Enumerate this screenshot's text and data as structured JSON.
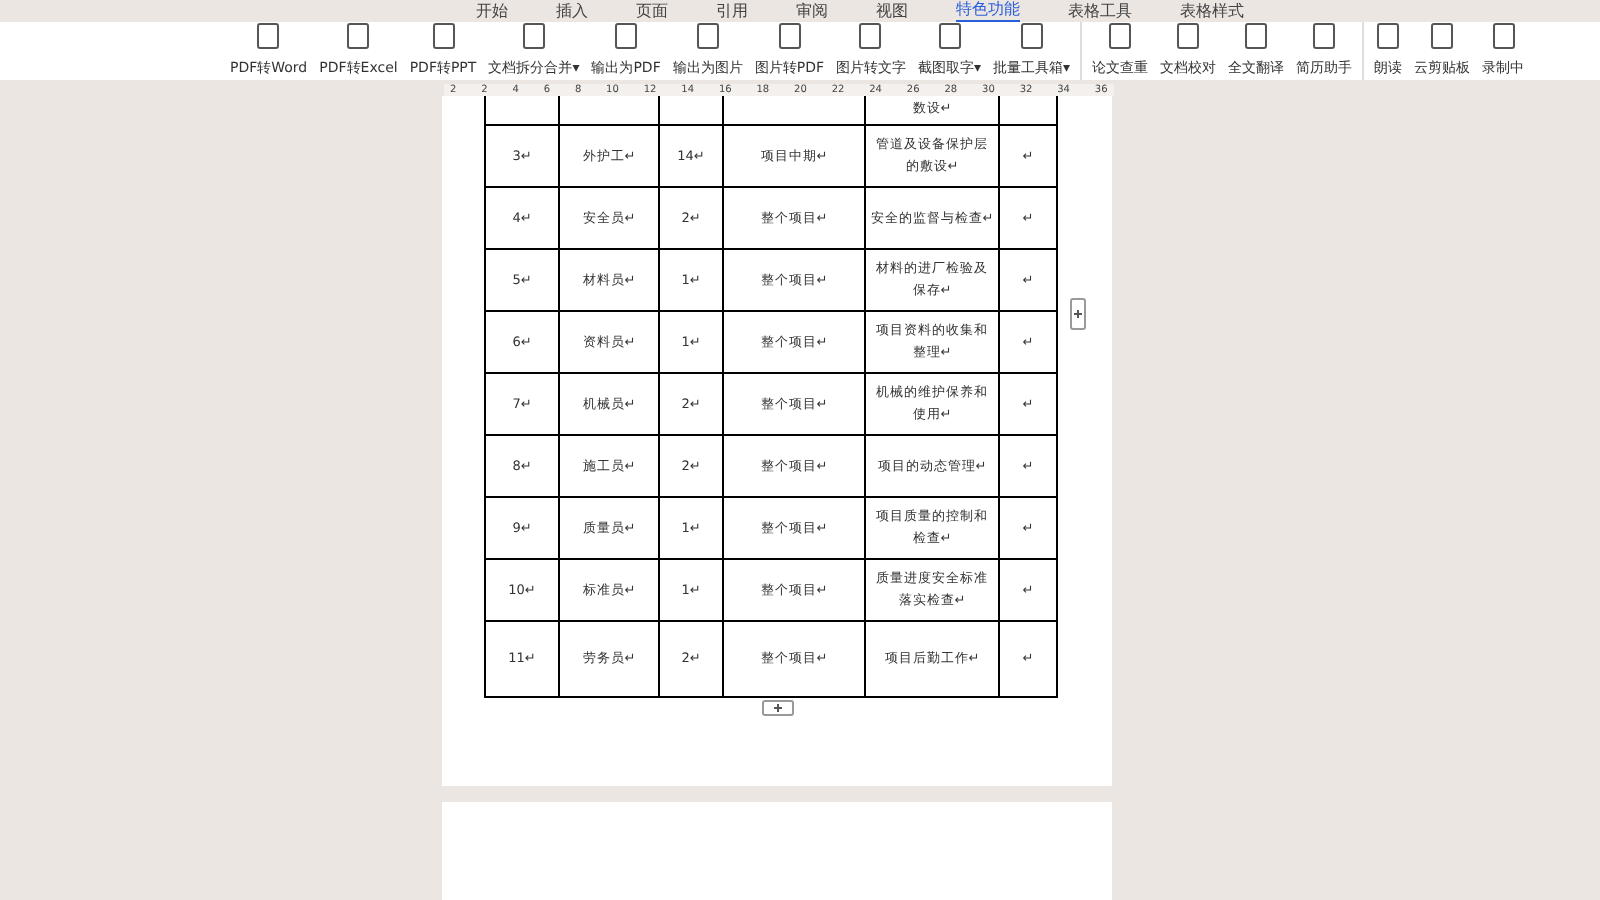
{
  "menu_tabs": [
    {
      "label": "开始",
      "selected": false
    },
    {
      "label": "插入",
      "selected": false
    },
    {
      "label": "页面",
      "selected": false
    },
    {
      "label": "引用",
      "selected": false
    },
    {
      "label": "审阅",
      "selected": false
    },
    {
      "label": "视图",
      "selected": false
    },
    {
      "label": "特色功能",
      "selected": true
    },
    {
      "label": "表格工具",
      "selected": false
    },
    {
      "label": "表格样式",
      "selected": false
    }
  ],
  "toolbar_groups": [
    [
      {
        "label": "PDF转Word"
      },
      {
        "label": "PDF转Excel"
      },
      {
        "label": "PDF转PPT"
      },
      {
        "label": "文档拆分合并▾"
      },
      {
        "label": "输出为PDF"
      },
      {
        "label": "输出为图片"
      },
      {
        "label": "图片转PDF"
      },
      {
        "label": "图片转文字"
      },
      {
        "label": "截图取字▾"
      },
      {
        "label": "批量工具箱▾"
      }
    ],
    [
      {
        "label": "论文查重"
      },
      {
        "label": "文档校对"
      },
      {
        "label": "全文翻译"
      },
      {
        "label": "简历助手"
      }
    ],
    [
      {
        "label": "朗读"
      },
      {
        "label": "云剪贴板"
      },
      {
        "label": "录制中"
      }
    ]
  ],
  "ruler": [
    "2",
    "2",
    "4",
    "6",
    "8",
    "10",
    "12",
    "14",
    "16",
    "18",
    "20",
    "22",
    "24",
    "26",
    "28",
    "30",
    "32",
    "34",
    "36"
  ],
  "table": {
    "rows": [
      [
        "",
        "",
        "",
        "",
        "数设↵",
        ""
      ],
      [
        "3↵",
        "外护工↵",
        "14↵",
        "项目中期↵",
        "管道及设备保护层的敷设↵",
        "↵"
      ],
      [
        "4↵",
        "安全员↵",
        "2↵",
        "整个项目↵",
        "安全的监督与检查↵",
        "↵"
      ],
      [
        "5↵",
        "材料员↵",
        "1↵",
        "整个项目↵",
        "材料的进厂检验及保存↵",
        "↵"
      ],
      [
        "6↵",
        "资料员↵",
        "1↵",
        "整个项目↵",
        "项目资料的收集和整理↵",
        "↵"
      ],
      [
        "7↵",
        "机械员↵",
        "2↵",
        "整个项目↵",
        "机械的维护保养和使用↵",
        "↵"
      ],
      [
        "8↵",
        "施工员↵",
        "2↵",
        "整个项目↵",
        "项目的动态管理↵",
        "↵"
      ],
      [
        "9↵",
        "质量员↵",
        "1↵",
        "整个项目↵",
        "项目质量的控制和检查↵",
        "↵"
      ],
      [
        "10↵",
        "标准员↵",
        "1↵",
        "整个项目↵",
        "质量进度安全标准落实检查↵",
        "↵"
      ],
      [
        "11↵",
        "劳务员↵",
        "2↵",
        "整个项目↵",
        "项目后勤工作↵",
        "↵"
      ]
    ]
  }
}
